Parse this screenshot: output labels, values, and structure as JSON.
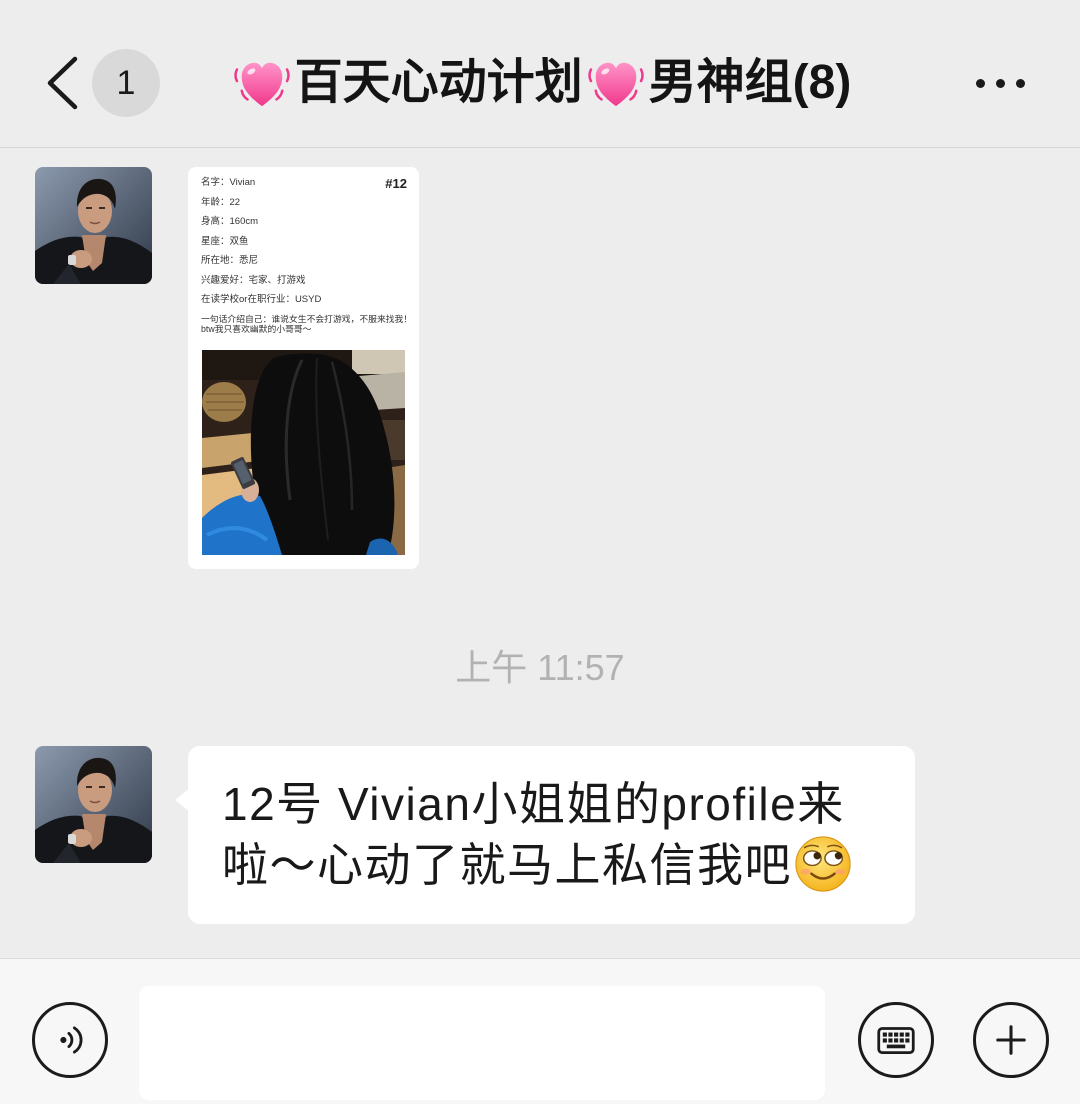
{
  "header": {
    "back_icon": "chevron-left-icon",
    "unread_count": "1",
    "title": {
      "heart_icon": "beating-heart-icon",
      "part_1": "百天心动计划",
      "part_2": "男神组(8)"
    },
    "more_icon": "more-dots-icon"
  },
  "chat": {
    "image_message": {
      "card": {
        "number": "#12",
        "lines": [
          "名字：Vivian",
          "年龄：22",
          "身高：160cm",
          "星座：双鱼",
          "所在地：悉尼",
          "兴趣爱好：宅家、打游戏",
          "在读学校or在职行业：USYD"
        ],
        "intro": [
          "一句话介绍自己：谁说女生不会打游戏，不服来找我！",
          "btw我只喜欢幽默的小哥哥～"
        ]
      }
    },
    "timestamp": "上午 11:57",
    "text_message": {
      "text": "12号 Vivian小姐姐的profile来啦～心动了就马上私信我吧",
      "trailing_emoji": "smirk-emoji-icon"
    }
  },
  "input_bar": {
    "voice_icon": "voice-icon",
    "value": "",
    "keyboard_icon": "keyboard-icon",
    "plus_icon": "plus-icon"
  },
  "theme": {
    "background": "#ededed",
    "bubble": "#ffffff",
    "text": "#191919",
    "timestamp": "#b2b2b2",
    "input_bar": "#f7f7f7",
    "heart_pink": "#f0388c"
  }
}
